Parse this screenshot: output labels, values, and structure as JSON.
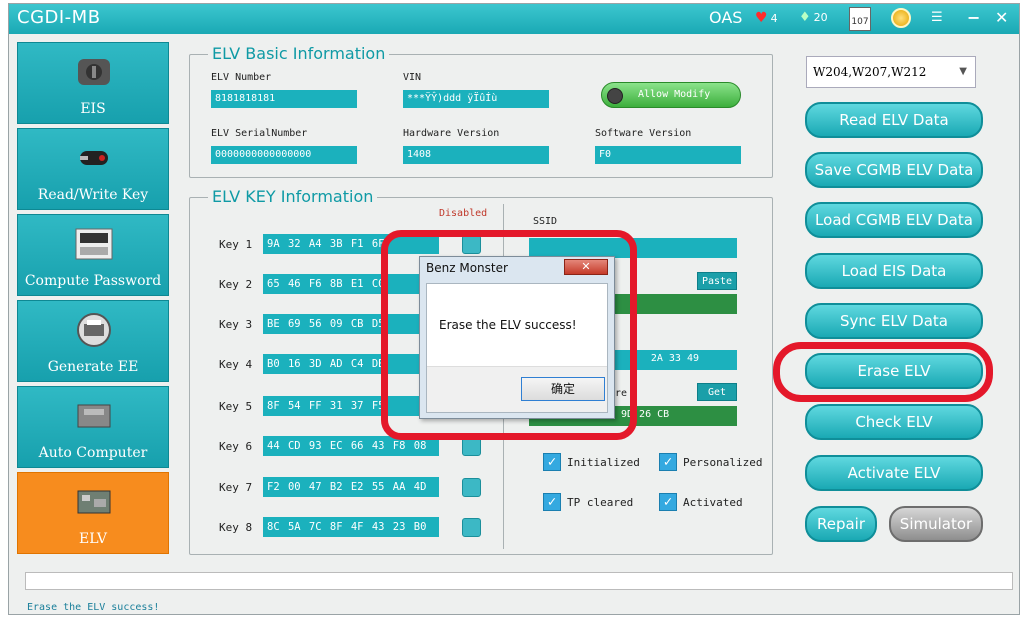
{
  "window": {
    "title": "CGDI-MB",
    "oas_label": "OAS",
    "hearts": "4",
    "gems": "20",
    "calendar": "107",
    "min_label": "−",
    "close_label": "✕"
  },
  "sidebar": {
    "items": [
      {
        "label": "EIS",
        "icon": "ignition-icon"
      },
      {
        "label": "Read/Write Key",
        "icon": "car-key-icon"
      },
      {
        "label": "Compute Password",
        "icon": "keypad-icon"
      },
      {
        "label": "Generate EE",
        "icon": "printer-icon"
      },
      {
        "label": "Auto Computer",
        "icon": "ecu-icon"
      },
      {
        "label": "ELV",
        "icon": "circuit-board-icon"
      }
    ]
  },
  "basic": {
    "title": "ELV Basic Information",
    "elv_number_label": "ELV Number",
    "elv_number": "8181818181",
    "vin_label": "VIN",
    "vin": "***ŸŶ)ddd ÿÏûÍù",
    "allow_modify": "Allow Modify",
    "serial_label": "ELV SerialNumber",
    "serial": "0000000000000000",
    "hw_label": "Hardware Version",
    "hw": "1408",
    "sw_label": "Software Version",
    "sw": "F0"
  },
  "keys": {
    "title": "ELV KEY Information",
    "disabled_label": "Disabled",
    "ssid_label": "SSID",
    "paste_label": "Paste",
    "get_label": "Get",
    "row4_tail": "2A 33 49",
    "row5_tail": "9D 26 CB",
    "partial_label": "re",
    "list": [
      {
        "label": "Key 1",
        "value": "9A 32 A4 3B F1 6F"
      },
      {
        "label": "Key 2",
        "value": "65 46 F6 8B E1 C0"
      },
      {
        "label": "Key 3",
        "value": "BE 69 56 09 CB D5"
      },
      {
        "label": "Key 4",
        "value": "B0 16 3D AD C4 DB"
      },
      {
        "label": "Key 5",
        "value": "8F 54 FF 31 37 F5"
      },
      {
        "label": "Key 6",
        "value": "44 CD 93 EC 66 43 F8 08"
      },
      {
        "label": "Key 7",
        "value": "F2 00 47 B2 E2 55 AA 4D"
      },
      {
        "label": "Key 8",
        "value": "8C 5A 7C 8F 4F 43 23 B0"
      }
    ],
    "checks": {
      "initialized": "Initialized",
      "personalized": "Personalized",
      "tp_cleared": "TP cleared",
      "activated": "Activated"
    }
  },
  "right": {
    "model": "W204,W207,W212",
    "buttons": [
      "Read  ELV Data",
      "Save CGMB ELV Data",
      "Load CGMB ELV Data",
      "Load EIS Data",
      "Sync ELV Data",
      "Erase ELV",
      "Check ELV",
      "Activate ELV"
    ],
    "repair": "Repair",
    "simulator": "Simulator"
  },
  "dialog": {
    "title": "Benz Monster",
    "close": "✕",
    "message": "Erase the ELV success!",
    "ok": "确定"
  },
  "status": "Erase the ELV success!"
}
